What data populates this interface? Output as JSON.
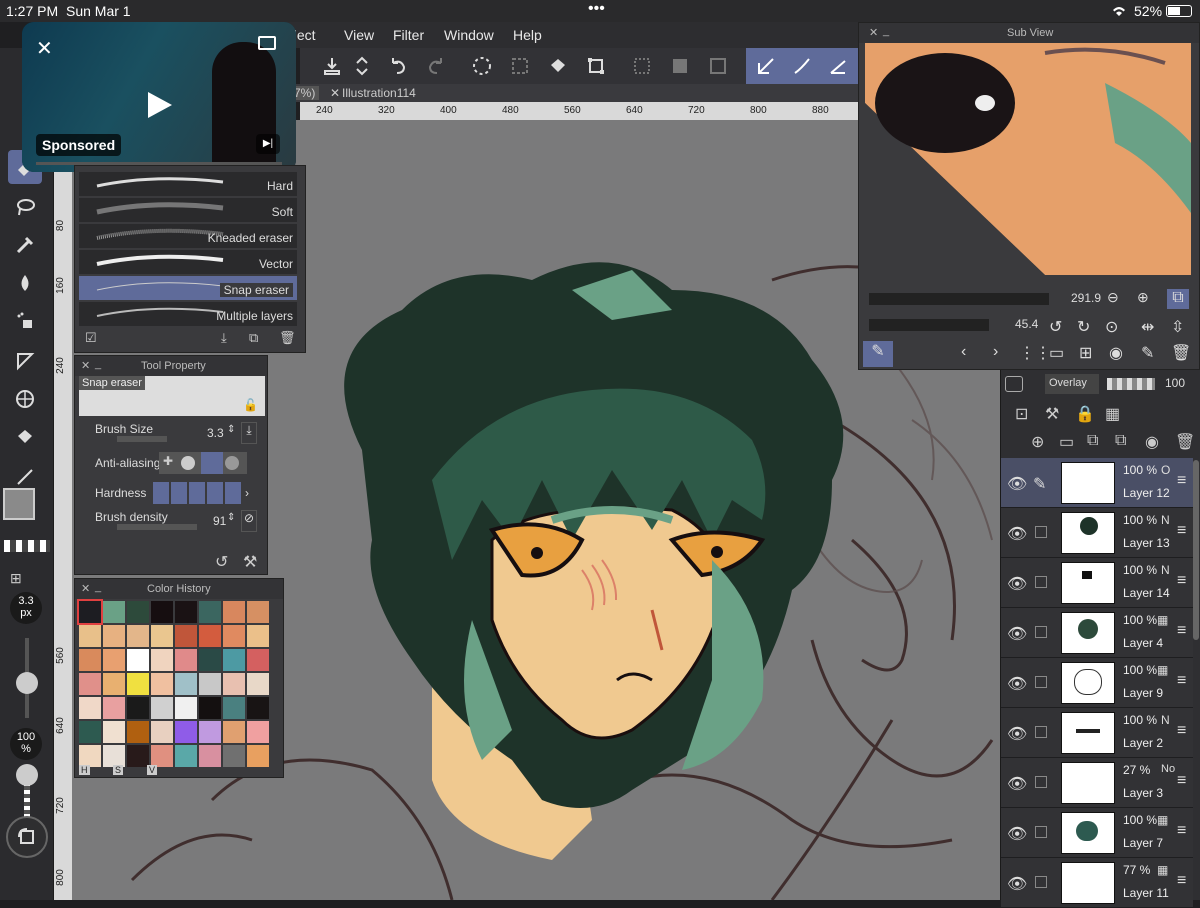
{
  "status_bar": {
    "time": "1:27 PM",
    "date": "Sun Mar 1",
    "battery": "52%",
    "dots": "•••"
  },
  "menu": {
    "items": [
      "elect",
      "View",
      "Filter",
      "Window",
      "Help"
    ]
  },
  "tabs": {
    "active": "7%)",
    "doc": "Illustration114"
  },
  "ruler": {
    "top": [
      "240",
      "320",
      "400",
      "480",
      "560",
      "640",
      "720",
      "800",
      "880"
    ],
    "left": [
      "80",
      "160",
      "240",
      "560",
      "640",
      "720",
      "800"
    ]
  },
  "video": {
    "sponsored": "Sponsored"
  },
  "brush_panel": {
    "items": [
      "Hard",
      "Soft",
      "Kneaded eraser",
      "Vector",
      "Snap eraser",
      "Multiple layers"
    ]
  },
  "tool_property": {
    "title": "Tool Property",
    "preview_name": "Snap eraser",
    "brush_size_label": "Brush Size",
    "brush_size_value": "3.3",
    "antialias_label": "Anti-aliasing",
    "hardness_label": "Hardness",
    "density_label": "Brush density",
    "density_value": "91"
  },
  "color_history": {
    "title": "Color History",
    "footer": [
      "H",
      "S",
      "V"
    ],
    "colors": [
      "#1d1d22",
      "#6aa186",
      "#2d4a3b",
      "#160e10",
      "#1a1214",
      "#3b6660",
      "#d8875e",
      "#d69063",
      "#e8c08a",
      "#e7b181",
      "#e3b68a",
      "#eac68f",
      "#c0563a",
      "#d35c3e",
      "#e08a60",
      "#ebc08a",
      "#d98a5c",
      "#e8a070",
      "#ffffff",
      "#f0d4bf",
      "#e08a8a",
      "#2a4a46",
      "#4d9aa3",
      "#d46060",
      "#e0908a",
      "#e8b070",
      "#f0e040",
      "#f0c0a0",
      "#a0c0c8",
      "#c8c8c8",
      "#e8c0b0",
      "#e8d8c8",
      "#f0d8c8",
      "#e8a0a0",
      "#1a1a1a",
      "#d0d0d0",
      "#f0f0f0",
      "#141010",
      "#4a8080",
      "#181414",
      "#2d5a50",
      "#f0e0d0",
      "#b06010",
      "#e8d0c0",
      "#8f5ce8",
      "#c09ae0",
      "#e0a070",
      "#f0a0a0",
      "#f0d8c0",
      "#e8e0d8",
      "#281a1a",
      "#e09080",
      "#5aa8a8",
      "#d890a0",
      "#707070",
      "#e8a060"
    ]
  },
  "left_tools": {
    "size_value": "3.3",
    "size_unit": "px",
    "opacity_value": "100",
    "opacity_unit": "%"
  },
  "subview": {
    "title": "Sub View",
    "zoom": "291.9",
    "rotation": "45.4"
  },
  "layer_panel": {
    "blend_mode": "Overlay",
    "opacity": "100",
    "layers": [
      {
        "opacity": "100 %",
        "mode": "O",
        "name": "Layer 12",
        "selected": true
      },
      {
        "opacity": "100 %",
        "mode": "N",
        "name": "Layer 13"
      },
      {
        "opacity": "100 %",
        "mode": "N",
        "name": "Layer 14"
      },
      {
        "opacity": "100 %",
        "mode": "",
        "name": "Layer 4"
      },
      {
        "opacity": "100 %",
        "mode": "",
        "name": "Layer 9"
      },
      {
        "opacity": "100 %",
        "mode": "N",
        "name": "Layer 2"
      },
      {
        "opacity": "27 %",
        "mode": "No",
        "name": "Layer 3"
      },
      {
        "opacity": "100 %",
        "mode": "",
        "name": "Layer 7"
      },
      {
        "opacity": "77 %",
        "mode": "",
        "name": "Layer 11"
      }
    ]
  },
  "colors": {
    "accent": "#5f6b9a",
    "canvas_bg": "#7a7a7b",
    "panel_bg": "#3a3a3d",
    "hair": "#1e3329",
    "hair_light": "#6aa186",
    "skin": "#f0c990"
  }
}
